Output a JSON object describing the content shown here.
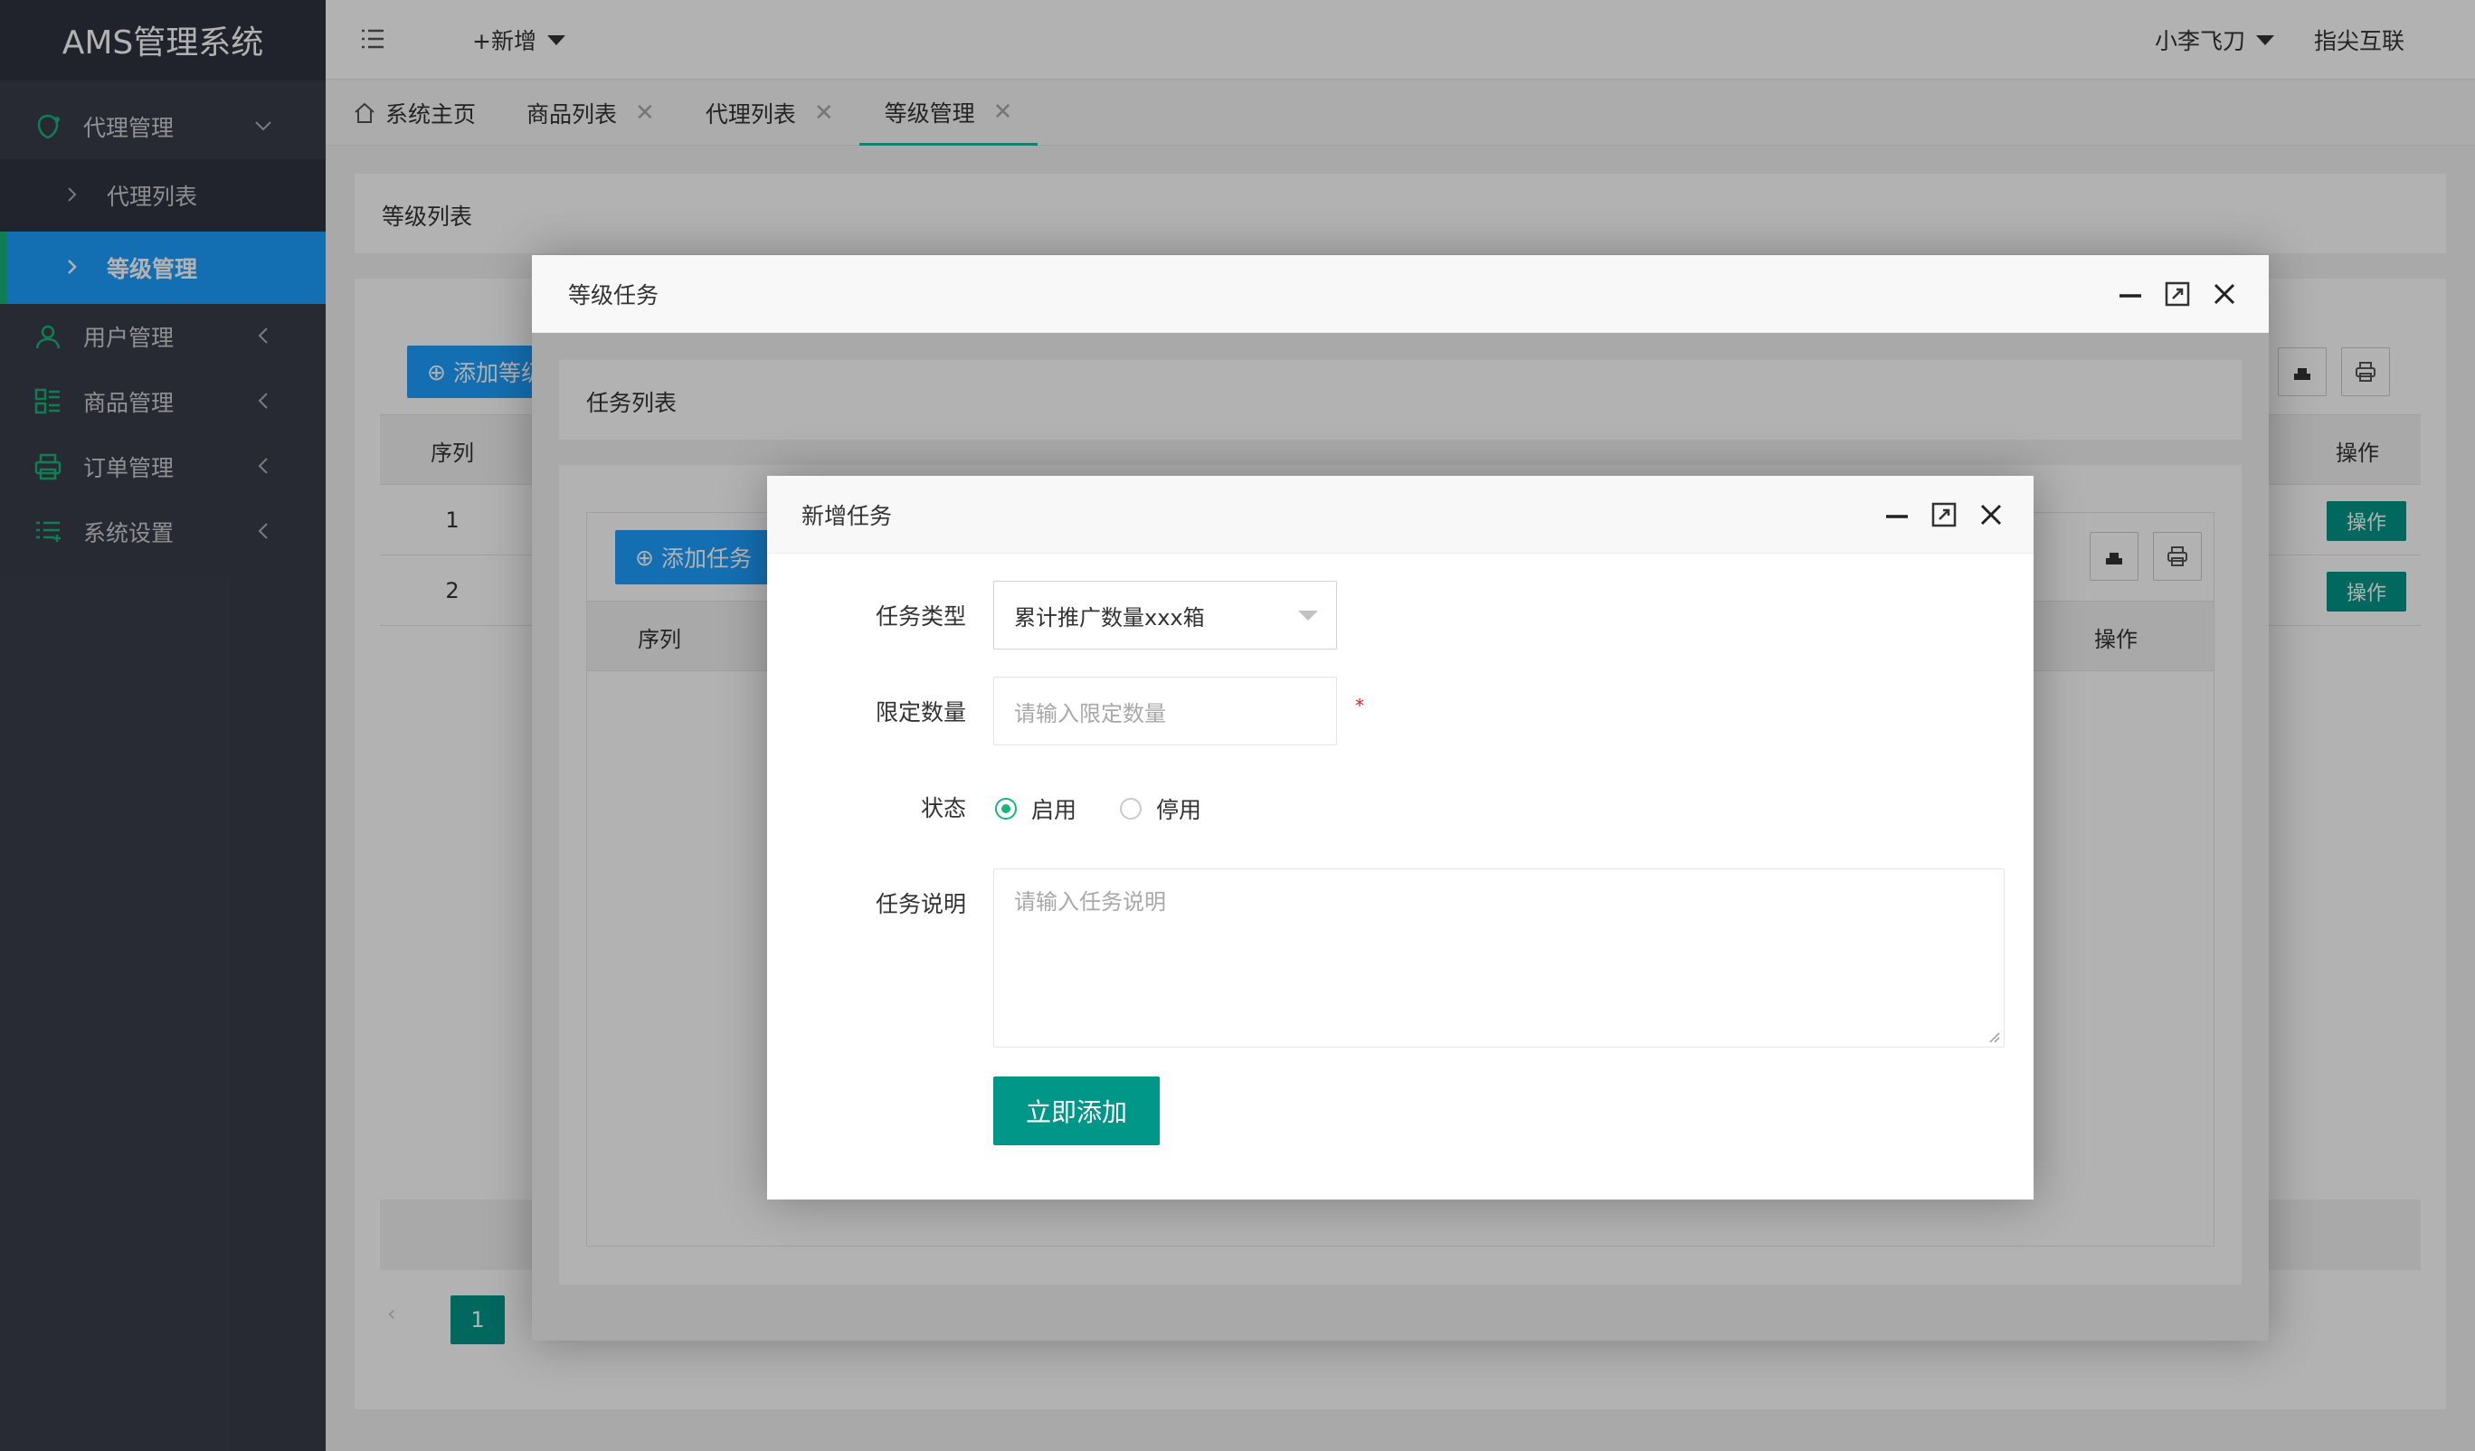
{
  "app": {
    "title": "AMS管理系统"
  },
  "header": {
    "new_label": "+新增",
    "user_name": "小李飞刀",
    "company": "指尖互联"
  },
  "sidebar": {
    "groups": [
      {
        "label": "代理管理",
        "icon": "agent-icon"
      },
      {
        "label": "用户管理",
        "icon": "user-icon"
      },
      {
        "label": "商品管理",
        "icon": "goods-icon"
      },
      {
        "label": "订单管理",
        "icon": "order-icon"
      },
      {
        "label": "系统设置",
        "icon": "settings-icon"
      }
    ],
    "sub_items": [
      {
        "label": "代理列表"
      },
      {
        "label": "等级管理",
        "active": true
      }
    ]
  },
  "tabs": [
    {
      "label": "系统主页",
      "icon": "home-icon"
    },
    {
      "label": "商品列表"
    },
    {
      "label": "代理列表"
    },
    {
      "label": "等级管理",
      "active": true
    }
  ],
  "background_page": {
    "card_title": "等级列表",
    "add_button": "添加等级",
    "col_index": "序列",
    "col_action": "操作",
    "rows": [
      {
        "index": "1",
        "action": "操作"
      },
      {
        "index": "2",
        "action": "操作"
      }
    ],
    "page_current": "1"
  },
  "level_task_window": {
    "title": "等级任务",
    "card_title": "任务列表",
    "add_button": "添加任务",
    "col_index": "序列",
    "col_action": "操作"
  },
  "new_task_dialog": {
    "title": "新增任务",
    "type_label": "任务类型",
    "type_value": "累计推广数量xxx箱",
    "limit_label": "限定数量",
    "limit_placeholder": "请输入限定数量",
    "required_mark": "*",
    "status_label": "状态",
    "status_enabled": "启用",
    "status_disabled": "停用",
    "desc_label": "任务说明",
    "desc_placeholder": "请输入任务说明",
    "submit_label": "立即添加"
  },
  "colors": {
    "sidebar": "#393d49",
    "active_nav": "#1e9fff",
    "primary_button": "#009688",
    "accent_green": "#16b777"
  }
}
